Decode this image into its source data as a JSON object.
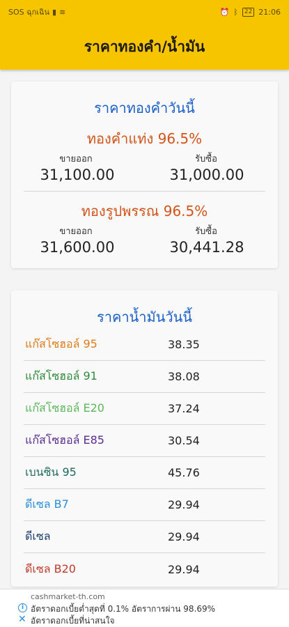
{
  "status_bar": {
    "left_text": "SOS ฉุกเฉิน",
    "time": "21:06",
    "battery": "22"
  },
  "app_bar": {
    "title": "ราคาทองคำ/น้ำมัน"
  },
  "gold_card": {
    "title": "ราคาทองคำวันนี้",
    "sections": [
      {
        "name": "ทองคำแท่ง 96.5%",
        "sell_label": "ขายออก",
        "sell_value": "31,100.00",
        "buy_label": "รับซื้อ",
        "buy_value": "31,000.00"
      },
      {
        "name": "ทองรูปพรรณ 96.5%",
        "sell_label": "ขายออก",
        "sell_value": "31,600.00",
        "buy_label": "รับซื้อ",
        "buy_value": "30,441.28"
      }
    ]
  },
  "oil_card": {
    "title": "ราคาน้ำมันวันนี้",
    "items": [
      {
        "name": "แก๊สโซฮอล์ 95",
        "price": "38.35",
        "color": "#e07b1a"
      },
      {
        "name": "แก๊สโซฮอล์ 91",
        "price": "38.08",
        "color": "#2e8b3a"
      },
      {
        "name": "แก๊สโซฮอล์ E20",
        "price": "37.24",
        "color": "#5cb85c"
      },
      {
        "name": "แก๊สโซฮอล์ E85",
        "price": "30.54",
        "color": "#5a2d91"
      },
      {
        "name": "เบนซิน 95",
        "price": "45.76",
        "color": "#1e6b5a"
      },
      {
        "name": "ดีเซล B7",
        "price": "29.94",
        "color": "#2a8fd8"
      },
      {
        "name": "ดีเซล",
        "price": "29.94",
        "color": "#1c3d6b"
      },
      {
        "name": "ดีเซล B20",
        "price": "29.94",
        "color": "#c0392b"
      }
    ]
  },
  "ad": {
    "domain": "cashmarket-th.com",
    "line1": "อัตราดอกเบี้ยต่ำสุดที่ 0.1% อัตราการผ่าน 98.69%",
    "line2": "อัตราดอกเบี้ยที่น่าสนใจ",
    "info_icon": "i",
    "close_icon": "✕"
  }
}
